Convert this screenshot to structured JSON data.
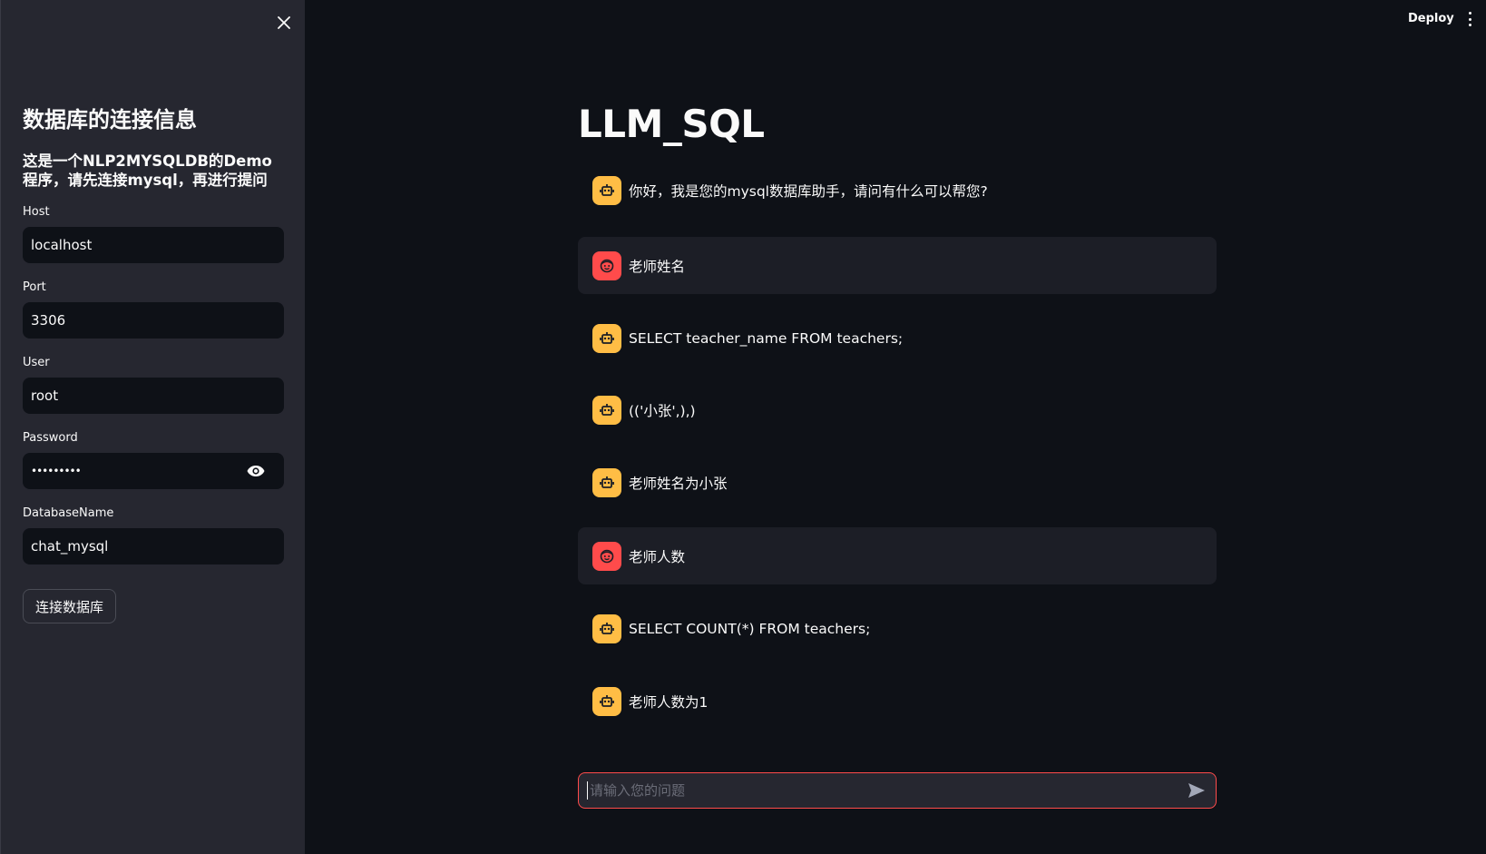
{
  "sidebar": {
    "title": "数据库的连接信息",
    "subtitle": "这是一个NLP2MYSQLDB的Demo程序，请先连接mysql，再进行提问",
    "fields": [
      {
        "label": "Host",
        "value": "localhost"
      },
      {
        "label": "Port",
        "value": "3306"
      },
      {
        "label": "User",
        "value": "root"
      },
      {
        "label": "Password",
        "value": "•••••••••"
      },
      {
        "label": "DatabaseName",
        "value": "chat_mysql"
      }
    ],
    "connect_button": "连接数据库",
    "close_icon": "close-icon",
    "password_toggle_icon": "eye-icon"
  },
  "topbar": {
    "deploy_label": "Deploy",
    "menu_icon": "kebab-menu-icon"
  },
  "main": {
    "title": "LLM_SQL",
    "messages": [
      {
        "role": "assistant",
        "text": "你好，我是您的mysql数据库助手，请问有什么可以帮您?"
      },
      {
        "role": "user",
        "text": "老师姓名"
      },
      {
        "role": "assistant",
        "text": "SELECT teacher_name FROM teachers;"
      },
      {
        "role": "assistant",
        "text": "(('小张',),)"
      },
      {
        "role": "assistant",
        "text": "老师姓名为小张"
      },
      {
        "role": "user",
        "text": "老师人数"
      },
      {
        "role": "assistant",
        "text": "SELECT COUNT(*) FROM teachers;"
      },
      {
        "role": "assistant",
        "text": "老师人数为1"
      }
    ],
    "chat_input": {
      "placeholder": "请输入您的问题",
      "value": ""
    }
  },
  "colors": {
    "background": "#0e1117",
    "sidebar": "#262730",
    "accent": "#ff4b4b",
    "bot_avatar": "#ffbd45",
    "user_avatar": "#ff4b4b"
  }
}
